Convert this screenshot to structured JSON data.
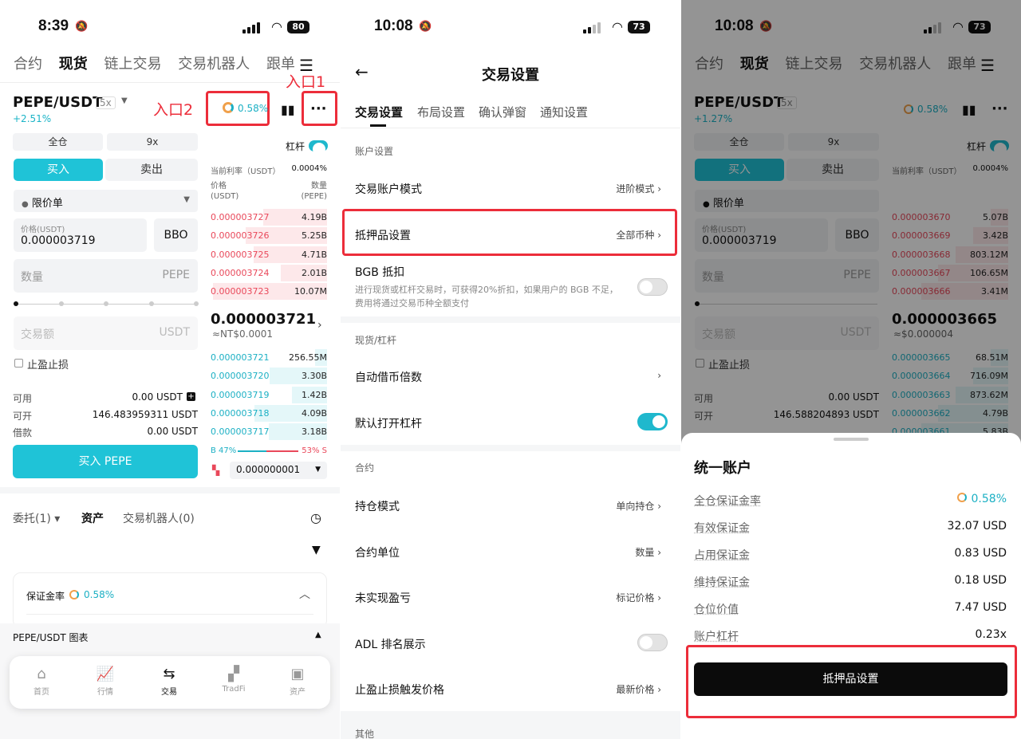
{
  "p1": {
    "status": {
      "time": "8:39",
      "battery": "80"
    },
    "topnav": [
      "合约",
      "现货",
      "链上交易",
      "交易机器人",
      "跟单"
    ],
    "symbol": "PEPE/USDT",
    "leverage_badge": "5x",
    "change": "+2.51%",
    "margin_ratio": "0.58%",
    "annot1": "入口1",
    "annot2": "入口2",
    "margin_mode": "全仓",
    "leverage": "9x",
    "leverage_label": "杠杆",
    "buy_tab": "买入",
    "sell_tab": "卖出",
    "order_type": "限价单",
    "price_label": "价格(USDT)",
    "price_value": "0.000003719",
    "bbo": "BBO",
    "qty_placeholder": "数量",
    "qty_unit": "PEPE",
    "amount_placeholder": "交易额",
    "amount_unit": "USDT",
    "tpsl": "止盈止损",
    "available_label": "可用",
    "available_value": "0.00 USDT",
    "openable_label": "可开",
    "openable_value": "146.483959311 USDT",
    "borrow_label": "借款",
    "borrow_value": "0.00 USDT",
    "buy_button": "买入 PEPE",
    "rate_label": "当前利率（USDT）",
    "rate_value": "0.0004%",
    "col_price": "价格",
    "col_price_unit": "(USDT)",
    "col_qty": "数量",
    "col_qty_unit": "(PEPE)",
    "asks": [
      {
        "p": "0.000003727",
        "q": "4.19B",
        "d": 0.55
      },
      {
        "p": "0.000003726",
        "q": "5.25B",
        "d": 0.7
      },
      {
        "p": "0.000003725",
        "q": "4.71B",
        "d": 0.63
      },
      {
        "p": "0.000003724",
        "q": "2.01B",
        "d": 0.4
      },
      {
        "p": "0.000003723",
        "q": "10.07M",
        "d": 0.98
      }
    ],
    "last_price": "0.000003721",
    "last_fiat": "≈NT$0.0001",
    "bids": [
      {
        "p": "0.000003721",
        "q": "256.55M",
        "d": 0.1
      },
      {
        "p": "0.000003720",
        "q": "3.30B",
        "d": 0.49
      },
      {
        "p": "0.000003719",
        "q": "1.42B",
        "d": 0.3
      },
      {
        "p": "0.000003718",
        "q": "4.09B",
        "d": 0.62
      },
      {
        "p": "0.000003717",
        "q": "3.18B",
        "d": 0.5
      }
    ],
    "ratio_b": "B 47%",
    "ratio_s": "53% S",
    "ratio_b_frac": 0.47,
    "precision": "0.000000001",
    "bottom_tabs": [
      "委托(1)",
      "资产",
      "交易机器人(0)"
    ],
    "margin_card_label": "保证金率",
    "margin_card_value": "0.58%",
    "chart_row": "PEPE/USDT 图表",
    "nav": [
      "首页",
      "行情",
      "交易",
      "TradFi",
      "资产"
    ]
  },
  "p2": {
    "status": {
      "time": "10:08",
      "battery": "73"
    },
    "title": "交易设置",
    "tabs": [
      "交易设置",
      "布局设置",
      "确认弹窗",
      "通知设置"
    ],
    "sec_account": "账户设置",
    "account_mode": "交易账户模式",
    "account_mode_val": "进阶模式",
    "collateral": "抵押品设置",
    "collateral_val": "全部币种",
    "bgb": "BGB 抵扣",
    "bgb_desc": "进行现货或杠杆交易时，可获得20%折扣，如果用户的 BGB 不足，费用将通过交易币种全额支付",
    "sec_spot": "现货/杠杆",
    "auto_borrow": "自动借币倍数",
    "default_margin": "默认打开杠杆",
    "sec_futures": "合约",
    "position_mode": "持仓模式",
    "position_mode_val": "单向持仓",
    "contract_unit": "合约单位",
    "contract_unit_val": "数量",
    "upnl": "未实现盈亏",
    "upnl_val": "标记价格",
    "adl": "ADL 排名展示",
    "tpsl_trigger": "止盈止损触发价格",
    "tpsl_trigger_val": "最新价格",
    "sec_other": "其他"
  },
  "p3": {
    "status": {
      "time": "10:08",
      "battery": "73"
    },
    "change": "+1.27%",
    "margin_ratio": "0.58%",
    "asks": [
      {
        "p": "0.000003670",
        "q": "5.07B"
      },
      {
        "p": "0.000003669",
        "q": "3.42B"
      },
      {
        "p": "0.000003668",
        "q": "803.12M"
      },
      {
        "p": "0.000003667",
        "q": "106.65M"
      },
      {
        "p": "0.000003666",
        "q": "3.41M"
      }
    ],
    "last_price": "0.000003665",
    "last_fiat": "≈$0.000004",
    "bids": [
      {
        "p": "0.000003665",
        "q": "68.51M"
      },
      {
        "p": "0.000003664",
        "q": "716.09M"
      },
      {
        "p": "0.000003663",
        "q": "873.62M"
      },
      {
        "p": "0.000003662",
        "q": "4.79B"
      },
      {
        "p": "0.000003661",
        "q": "5.83B"
      }
    ],
    "openable_value": "146.588204893 USDT",
    "sheet_title": "统一账户",
    "rows": [
      {
        "k": "全仓保证金率",
        "v": "0.58%"
      },
      {
        "k": "有效保证金",
        "v": "32.07 USD"
      },
      {
        "k": "占用保证金",
        "v": "0.83 USD"
      },
      {
        "k": "维持保证金",
        "v": "0.18 USD"
      },
      {
        "k": "仓位价值",
        "v": "7.47 USD"
      },
      {
        "k": "账户杠杆",
        "v": "0.23x"
      }
    ],
    "button": "抵押品设置"
  }
}
